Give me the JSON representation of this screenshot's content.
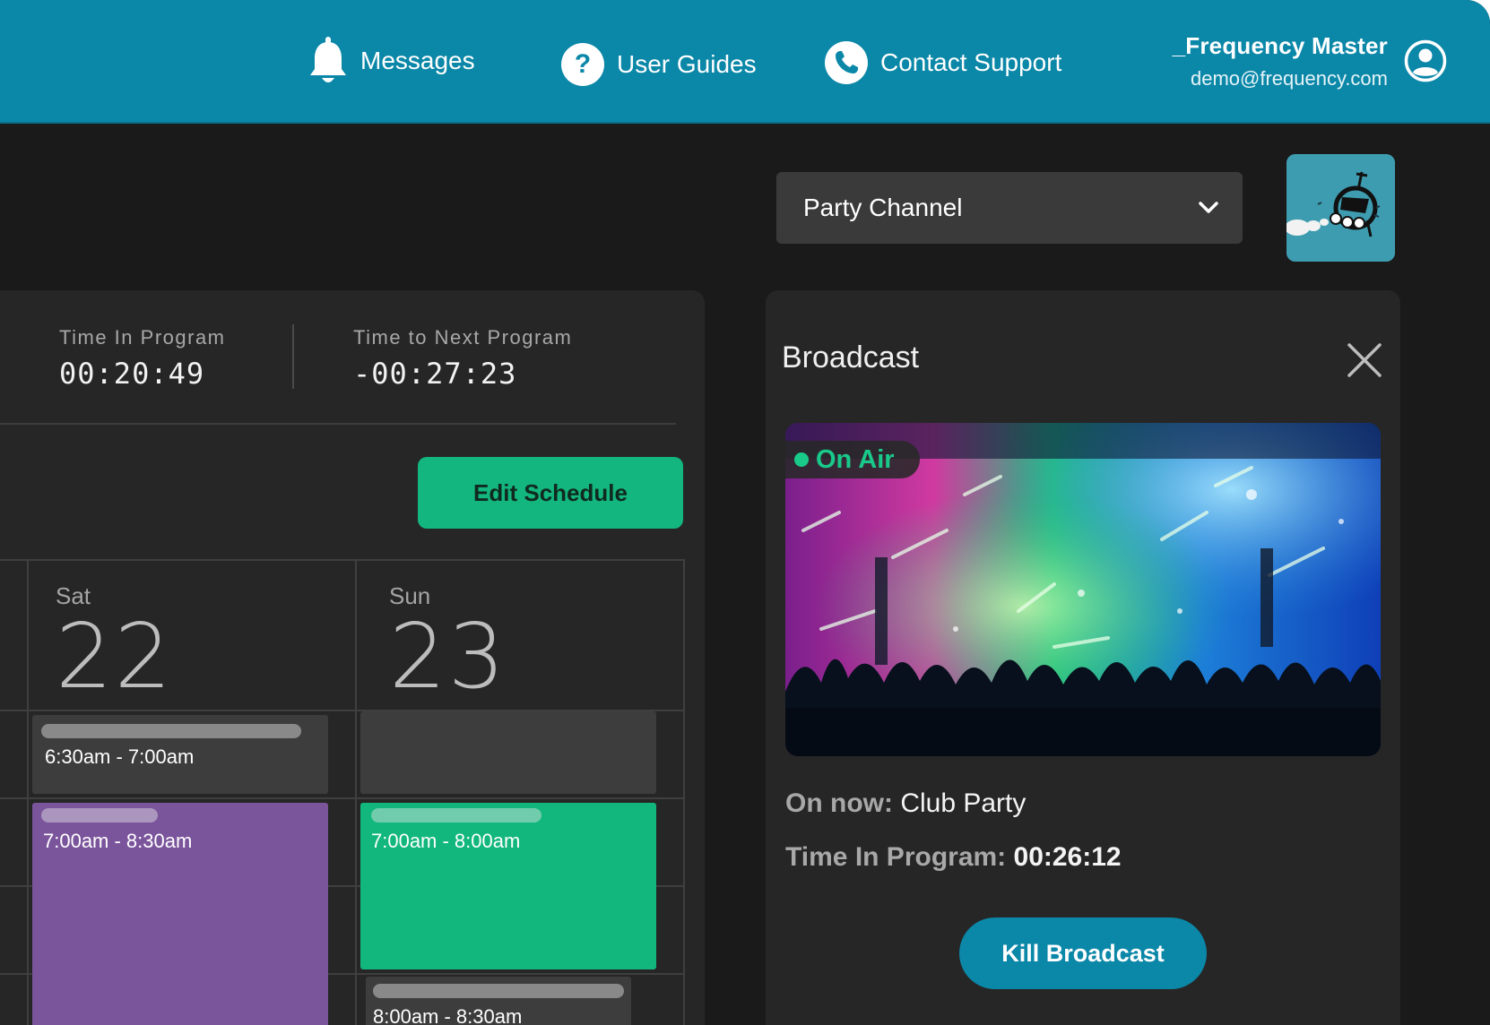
{
  "nav": {
    "messages_label": "Messages",
    "guides_label": "User Guides",
    "support_label": "Contact Support",
    "user_name": "_Frequency Master",
    "user_email": "demo@frequency.com"
  },
  "channel": {
    "selected": "Party Channel"
  },
  "schedule": {
    "time_in_program_label": "Time In Program",
    "time_in_program_value": "00:20:49",
    "time_to_next_label": "Time to Next Program",
    "time_to_next_value": "-00:27:23",
    "edit_button_label": "Edit Schedule",
    "days": [
      {
        "dow": "Sat",
        "date": "22"
      },
      {
        "dow": "Sun",
        "date": "23"
      }
    ],
    "events": [
      {
        "day": "Sat",
        "time": "6:30am - 7:00am",
        "color": "#3d3d3d"
      },
      {
        "day": "Sat",
        "time": "7:00am - 8:30am",
        "color": "#7b559c"
      },
      {
        "day": "Sun",
        "time": "7:00am - 8:00am",
        "color": "#12b77e"
      },
      {
        "day": "Sun",
        "time": "8:00am - 8:30am",
        "color": "#3d3d3d"
      }
    ]
  },
  "broadcast": {
    "title": "Broadcast",
    "status_badge": "On Air",
    "on_now_label": "On now:",
    "on_now_value": "Club Party",
    "time_in_program_label": "Time In Program:",
    "time_in_program_value": "00:26:12",
    "kill_button_label": "Kill Broadcast"
  },
  "colors": {
    "header": "#0b87a8",
    "accent_green": "#13b67e",
    "event_purple": "#7b559c",
    "panel": "#262626",
    "background": "#1a1a1a"
  }
}
